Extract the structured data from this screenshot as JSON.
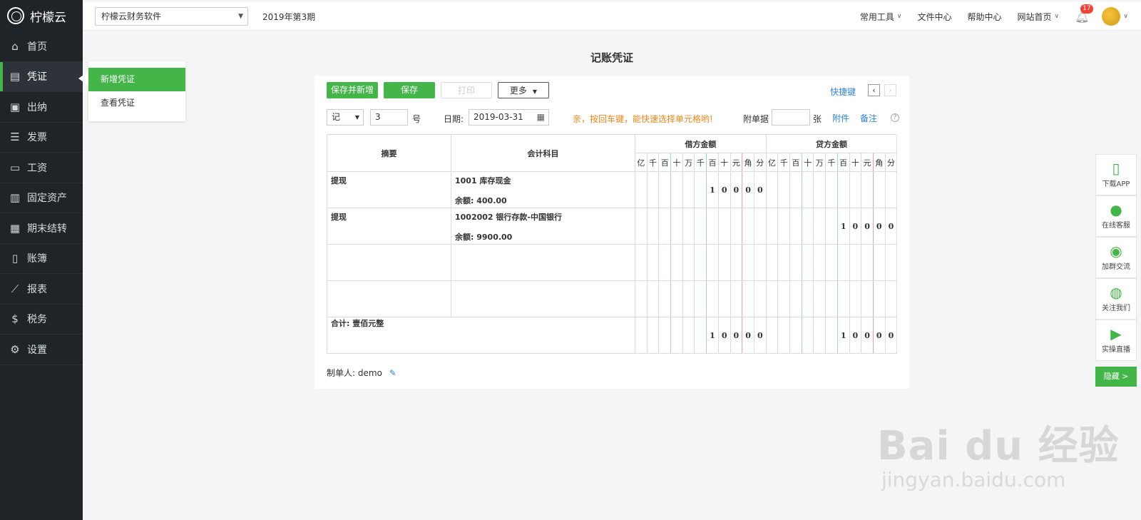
{
  "app": {
    "name": "柠檬云"
  },
  "sidebar": {
    "items": [
      {
        "label": "首页",
        "icon": "home-icon",
        "glyph": "⌂"
      },
      {
        "label": "凭证",
        "icon": "voucher-icon",
        "glyph": "▤"
      },
      {
        "label": "出纳",
        "icon": "cashier-icon",
        "glyph": "▣"
      },
      {
        "label": "发票",
        "icon": "invoice-icon",
        "glyph": "☰"
      },
      {
        "label": "工资",
        "icon": "salary-icon",
        "glyph": "▭"
      },
      {
        "label": "固定资产",
        "icon": "asset-icon",
        "glyph": "▥"
      },
      {
        "label": "期末结转",
        "icon": "calendar-icon",
        "glyph": "▦"
      },
      {
        "label": "账簿",
        "icon": "ledger-icon",
        "glyph": "▯"
      },
      {
        "label": "报表",
        "icon": "chart-icon",
        "glyph": "⟋"
      },
      {
        "label": "税务",
        "icon": "tax-icon",
        "glyph": "$"
      },
      {
        "label": "设置",
        "icon": "gear-icon",
        "glyph": "⚙"
      }
    ]
  },
  "flyout": {
    "items": [
      "新增凭证",
      "查看凭证"
    ]
  },
  "topbar": {
    "company": "柠檬云财务软件",
    "period": "2019年第3期",
    "links": [
      "常用工具",
      "文件中心",
      "帮助中心",
      "网站首页"
    ],
    "notifications": "17"
  },
  "page": {
    "title": "记账凭证"
  },
  "toolbar": {
    "save_new": "保存并新增",
    "save": "保存",
    "print": "打印",
    "more": "更多",
    "shortcut": "快捷键"
  },
  "form": {
    "voucher_word": "记",
    "voucher_no": "3",
    "no_suffix": "号",
    "date_label": "日期:",
    "date_value": "2019-03-31",
    "tip": "亲，按回车键，能快速选择单元格哟!",
    "attach_label": "附单据",
    "attach_unit": "张",
    "attachment_link": "附件",
    "note_link": "备注"
  },
  "table": {
    "headers": {
      "summary": "摘要",
      "account": "会计科目",
      "debit": "借方金额",
      "credit": "贷方金额"
    },
    "units": [
      "亿",
      "千",
      "百",
      "十",
      "万",
      "千",
      "百",
      "十",
      "元",
      "角",
      "分"
    ],
    "rows": [
      {
        "summary": "提现",
        "account": "1001 库存现金",
        "balance": "余额: 400.00",
        "debit": [
          "",
          "",
          "",
          "",
          "",
          "",
          "1",
          "0",
          "0",
          "0",
          "0"
        ],
        "credit": [
          "",
          "",
          "",
          "",
          "",
          "",
          "",
          "",
          "",
          "",
          ""
        ]
      },
      {
        "summary": "提现",
        "account": "1002002 银行存款-中国银行",
        "balance": "余额: 9900.00",
        "debit": [
          "",
          "",
          "",
          "",
          "",
          "",
          "",
          "",
          "",
          "",
          ""
        ],
        "credit": [
          "",
          "",
          "",
          "",
          "",
          "",
          "1",
          "0",
          "0",
          "0",
          "0"
        ]
      },
      {
        "summary": "",
        "account": "",
        "balance": "",
        "debit": [
          "",
          "",
          "",
          "",
          "",
          "",
          "",
          "",
          "",
          "",
          ""
        ],
        "credit": [
          "",
          "",
          "",
          "",
          "",
          "",
          "",
          "",
          "",
          "",
          ""
        ]
      },
      {
        "summary": "",
        "account": "",
        "balance": "",
        "debit": [
          "",
          "",
          "",
          "",
          "",
          "",
          "",
          "",
          "",
          "",
          ""
        ],
        "credit": [
          "",
          "",
          "",
          "",
          "",
          "",
          "",
          "",
          "",
          "",
          ""
        ]
      }
    ],
    "total": {
      "label": "合计: 壹佰元整",
      "debit": [
        "",
        "",
        "",
        "",
        "",
        "",
        "1",
        "0",
        "0",
        "0",
        "0"
      ],
      "credit": [
        "",
        "",
        "",
        "",
        "",
        "",
        "1",
        "0",
        "0",
        "0",
        "0"
      ]
    }
  },
  "maker": {
    "label": "制单人:",
    "name": "demo"
  },
  "side_panel": {
    "items": [
      {
        "label": "下载APP",
        "icon": "phone-icon",
        "glyph": "▯"
      },
      {
        "label": "在线客服",
        "icon": "qq-icon",
        "glyph": "●"
      },
      {
        "label": "加群交流",
        "icon": "group-icon",
        "glyph": "◉"
      },
      {
        "label": "关注我们",
        "icon": "wechat-icon",
        "glyph": "◍"
      },
      {
        "label": "实操直播",
        "icon": "video-icon",
        "glyph": "▶"
      }
    ],
    "hide": "隐藏 >"
  },
  "watermark": {
    "brand": "Bai du 经验",
    "url": "jingyan.baidu.com"
  },
  "colors": {
    "accent": "#43b549",
    "sidebar": "#1f2429",
    "link": "#2f86d6",
    "tip": "#f08519"
  }
}
